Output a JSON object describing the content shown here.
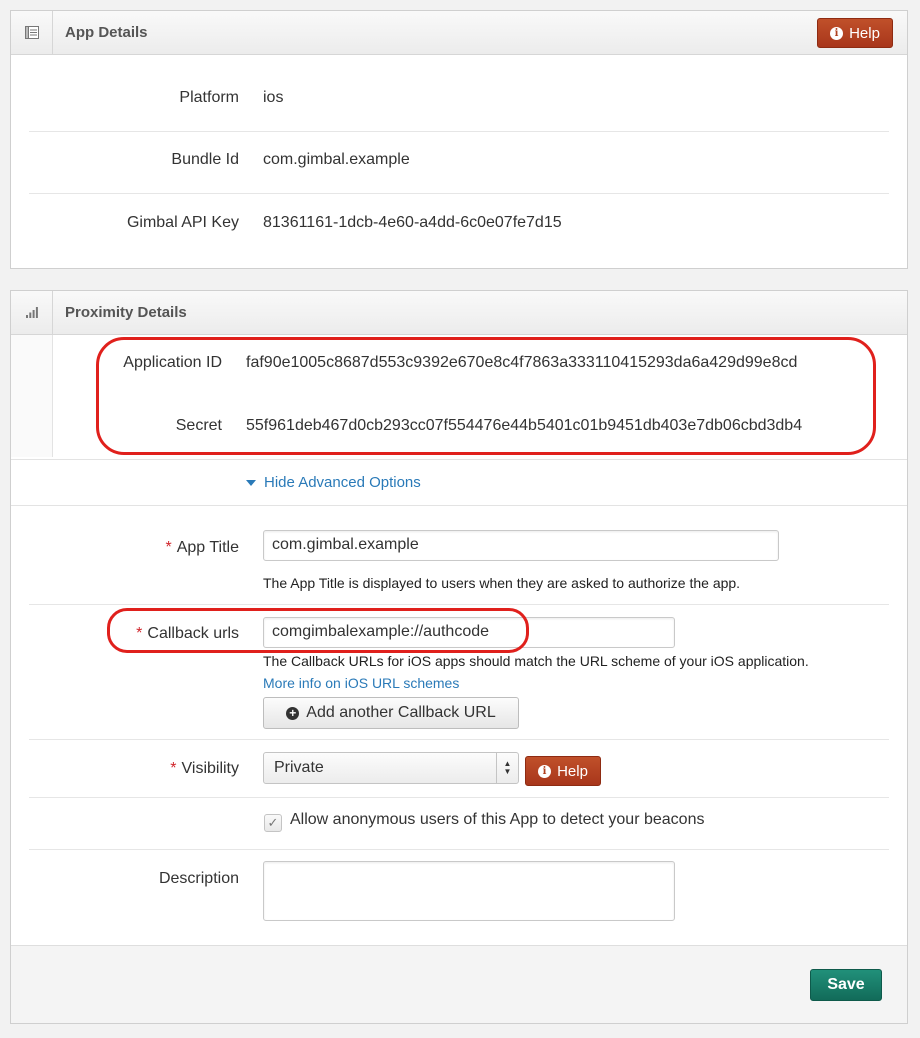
{
  "app_details": {
    "title": "App Details",
    "help_label": "Help",
    "rows": [
      {
        "label": "Platform",
        "value": "ios"
      },
      {
        "label": "Bundle Id",
        "value": "com.gimbal.example"
      },
      {
        "label": "Gimbal API Key",
        "value": "81361161-1dcb-4e60-a4dd-6c0e07fe7d15"
      }
    ]
  },
  "proximity_details": {
    "title": "Proximity Details",
    "application_id": {
      "label": "Application ID",
      "value": "faf90e1005c8687d553c9392e670e8c4f7863a333110415293da6a429d99e8cd"
    },
    "secret": {
      "label": "Secret",
      "value": "55f961deb467d0cb293cc07f554476e44b5401c01b9451db403e7db06cbd3db4"
    },
    "toggle_advanced": "Hide Advanced Options",
    "app_title": {
      "required": "*",
      "label": "App Title",
      "value": "com.gimbal.example",
      "help": "The App Title is displayed to users when they are asked to authorize the app."
    },
    "callback_urls": {
      "required": "*",
      "label": "Callback urls",
      "value": "comgimbalexample://authcode",
      "help": "The Callback URLs for iOS apps should match the URL scheme of your iOS application.",
      "more_info_link": "More info on iOS URL schemes",
      "add_button": "Add another Callback URL"
    },
    "visibility": {
      "required": "*",
      "label": "Visibility",
      "selected": "Private",
      "help_label": "Help"
    },
    "anonymous_checkbox": {
      "label": "Allow anonymous users of this App to detect your beacons",
      "checked": true
    },
    "description": {
      "label": "Description",
      "value": ""
    },
    "save_label": "Save"
  },
  "colors": {
    "highlight_oval": "#e0201c",
    "help_button": "#b0401f",
    "save_button": "#1a7f6b",
    "link": "#2a7ab8",
    "required_star": "#d0252b"
  }
}
